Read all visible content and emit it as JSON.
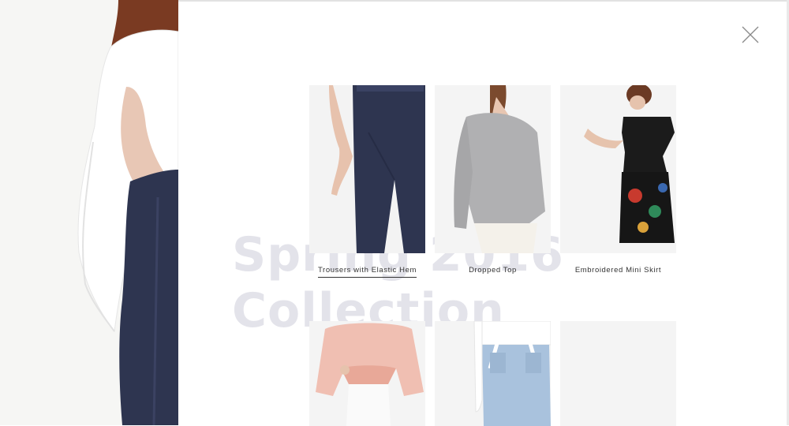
{
  "background": {
    "panel_color": "#f6f6f4"
  },
  "overlay": {
    "close_icon": "close-icon",
    "watermark_lines": [
      "Spring 2016",
      "Collection"
    ],
    "products": [
      {
        "name": "Trousers with Elastic Hem",
        "active": true
      },
      {
        "name": "Dropped Top",
        "active": false
      },
      {
        "name": "Embroidered Mini Skirt",
        "active": false
      },
      {
        "name": "",
        "active": false
      },
      {
        "name": "",
        "active": false
      },
      {
        "name": "",
        "active": false
      }
    ]
  },
  "colors": {
    "watermark": "#e3e3ea",
    "navy": "#2e3550",
    "text": "#333333"
  }
}
